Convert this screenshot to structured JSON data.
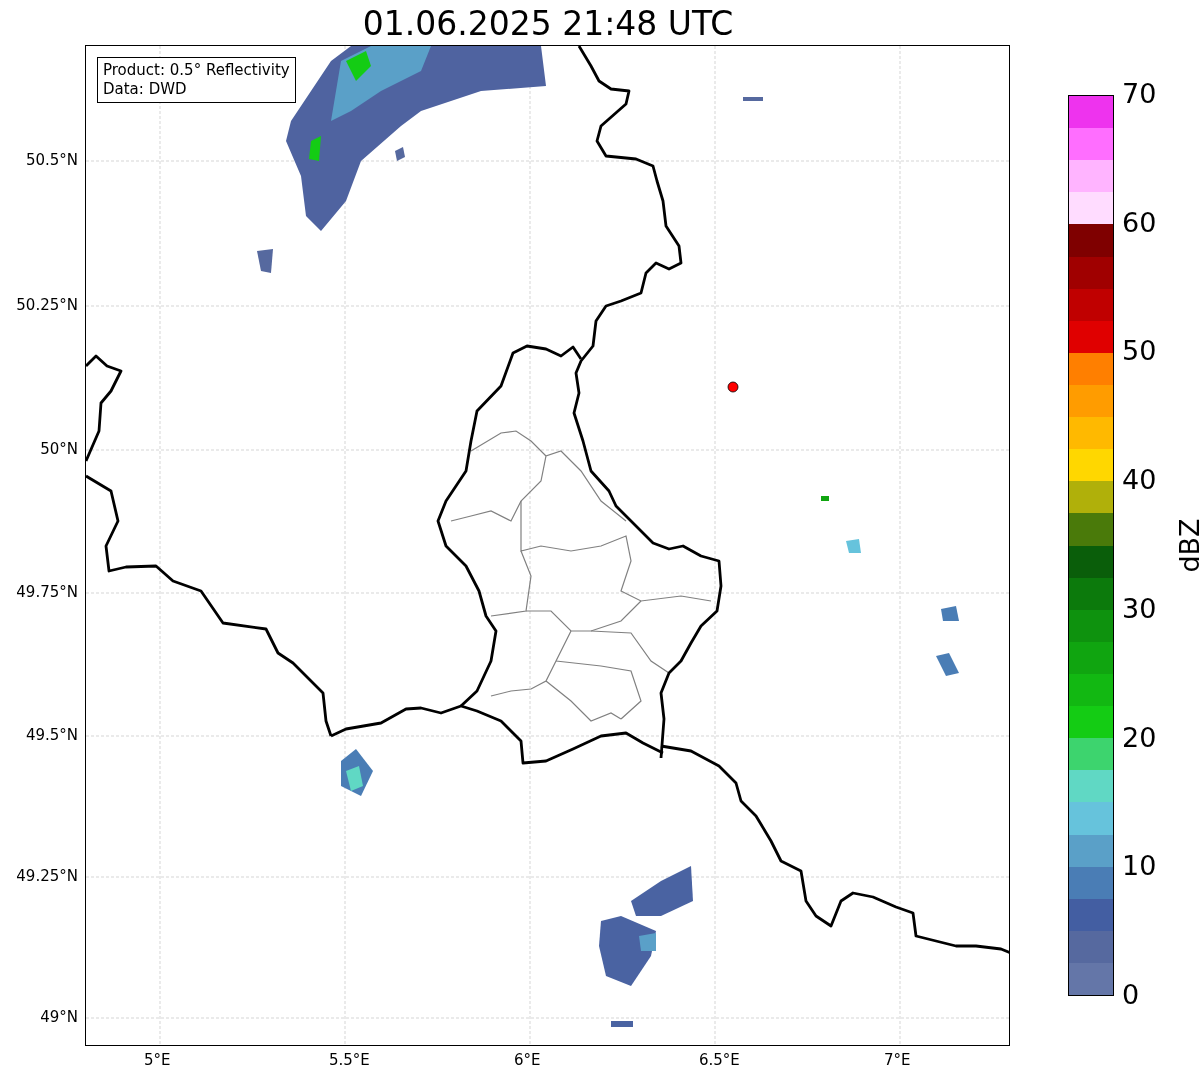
{
  "title": "01.06.2025 21:48 UTC",
  "info_box": {
    "lines": [
      "Product: 0.5° Reflectivity",
      "Data: DWD"
    ]
  },
  "map": {
    "lat_labels": [
      "50.5°N",
      "50.25°N",
      "50°N",
      "49.75°N",
      "49.5°N",
      "49.25°N",
      "49°N"
    ],
    "lon_labels": [
      "5°E",
      "5.5°E",
      "6°E",
      "6.5°E",
      "7°E"
    ]
  },
  "colorbar": {
    "label": "dBZ",
    "ticks": [
      "70",
      "60",
      "50",
      "40",
      "30",
      "20",
      "10",
      "0"
    ],
    "bands": [
      {
        "color": "#ee33ee"
      },
      {
        "color": "#ff6eff"
      },
      {
        "color": "#ffb4ff"
      },
      {
        "color": "#ffdcff"
      },
      {
        "color": "#7f0000"
      },
      {
        "color": "#a00000"
      },
      {
        "color": "#c00000"
      },
      {
        "color": "#e00000"
      },
      {
        "color": "#ff7f00"
      },
      {
        "color": "#ff9c00"
      },
      {
        "color": "#ffb900"
      },
      {
        "color": "#ffd700"
      },
      {
        "color": "#b0b00a"
      },
      {
        "color": "#4a7a0a"
      },
      {
        "color": "#0a5e0a"
      },
      {
        "color": "#0c7a0c"
      },
      {
        "color": "#0e920e"
      },
      {
        "color": "#10a510"
      },
      {
        "color": "#12b812"
      },
      {
        "color": "#14cc14"
      },
      {
        "color": "#3dd46e"
      },
      {
        "color": "#60d8c4"
      },
      {
        "color": "#66c3dc"
      },
      {
        "color": "#5aa0c8"
      },
      {
        "color": "#4a7db5"
      },
      {
        "color": "#435ea2"
      },
      {
        "color": "#56699f"
      },
      {
        "color": "#6476a8"
      }
    ]
  }
}
